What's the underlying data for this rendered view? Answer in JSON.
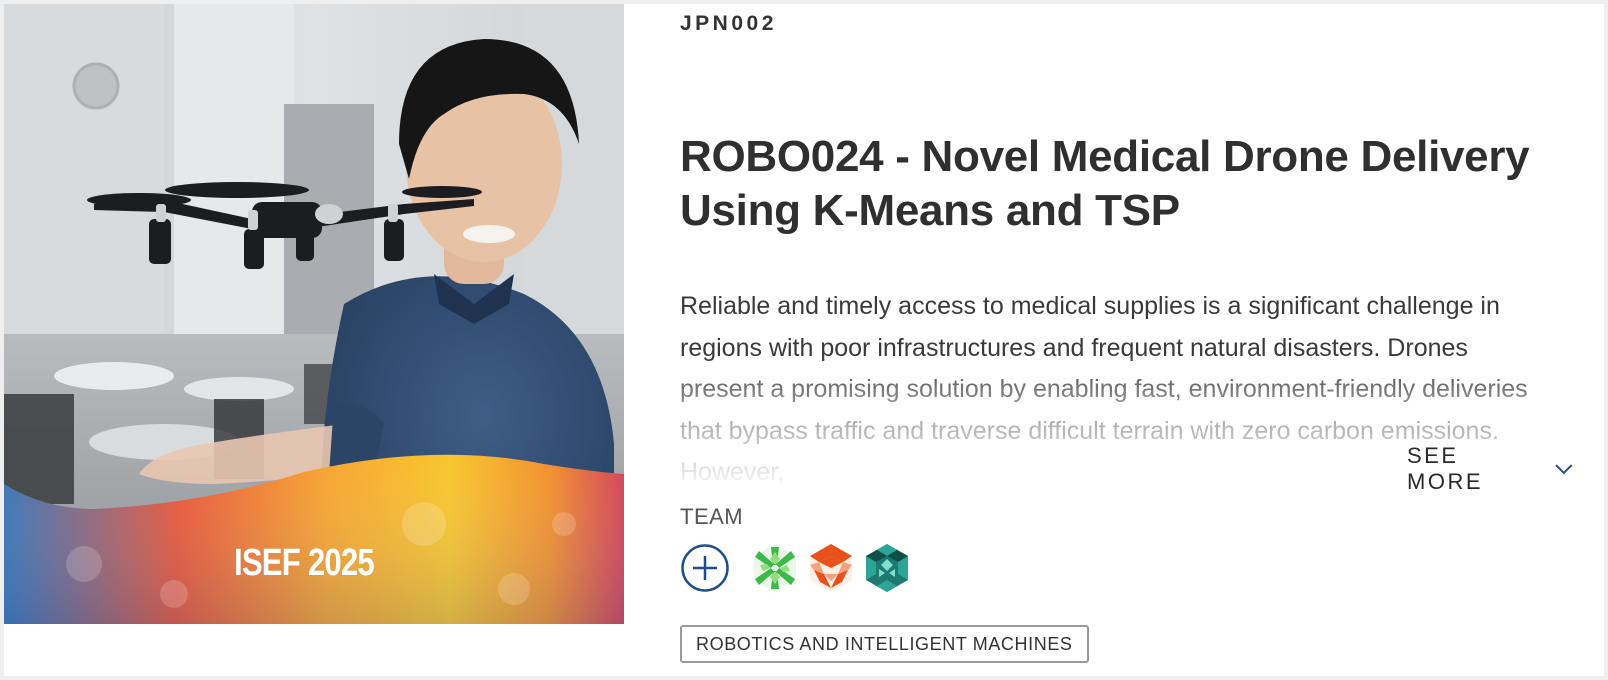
{
  "hero": {
    "event_badge": "ISEF 2025",
    "photo_icon": "drone-photo-icon"
  },
  "project": {
    "code": "JPN002",
    "title": "ROBO024 - Novel Medical Drone Delivery Using K-Means and TSP",
    "abstract": "Reliable and timely access to medical supplies is a significant challenge in regions with poor infrastructures and frequent natural disasters. Drones present a promising solution by enabling fast, environment-friendly deliveries that bypass traffic and traverse difficult terrain with zero carbon emissions. However,",
    "see_more_label": "SEE MORE",
    "see_more_icon": "chevron-down-icon"
  },
  "team": {
    "label": "TEAM",
    "add_icon": "plus-circle-icon",
    "members": [
      {
        "avatar": "green-asterisk-avatar-icon",
        "color": "#3db94a"
      },
      {
        "avatar": "orange-triangle-avatar-icon",
        "color": "#e8521a"
      },
      {
        "avatar": "teal-hexagon-avatar-icon",
        "color": "#1d7a70"
      }
    ]
  },
  "category": {
    "label": "ROBOTICS AND INTELLIGENT MACHINES"
  },
  "colors": {
    "accent": "#1f4e8c",
    "text": "#333333",
    "border": "#9a9a9a"
  }
}
